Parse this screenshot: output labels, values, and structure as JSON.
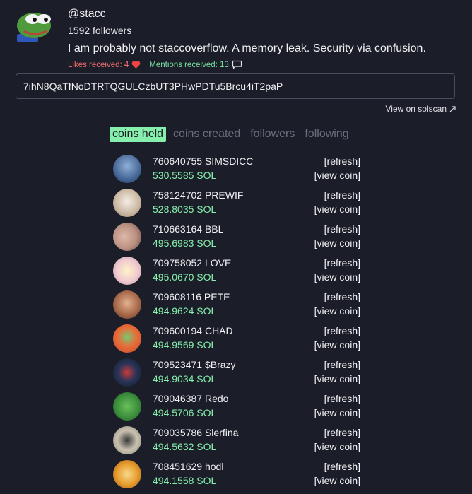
{
  "profile": {
    "username": "@stacc",
    "followers": "1592 followers",
    "bio": "I am probably not staccoverflow. A memory leak. Security via confusion.",
    "likes_label": "Likes received: 4",
    "mentions_label": "Mentions received: 13",
    "avatar_icon": "pepe-frog-avatar"
  },
  "address": {
    "value": "7ihN8QaTfNoDTRTQGULCzbUT3PHwPDTu5Brcu4iT2paP",
    "solscan_label": "View on solscan"
  },
  "tabs": [
    {
      "label": "coins held",
      "active": true
    },
    {
      "label": "coins created",
      "active": false
    },
    {
      "label": "followers",
      "active": false
    },
    {
      "label": "following",
      "active": false
    }
  ],
  "coins": [
    {
      "name": "760640755 SIMSDICC",
      "sol": "530.5585 SOL",
      "refresh": "[refresh]",
      "view": "[view coin]",
      "color": "#3a5a8a",
      "icon": "simsdicc-avatar"
    },
    {
      "name": "758124702 PREWIF",
      "sol": "528.8035 SOL",
      "refresh": "[refresh]",
      "view": "[view coin]",
      "color": "#c9b6a0",
      "icon": "prewif-avatar"
    },
    {
      "name": "710663164 BBL",
      "sol": "495.6983 SOL",
      "refresh": "[refresh]",
      "view": "[view coin]",
      "color": "#b88f80",
      "icon": "bbl-avatar"
    },
    {
      "name": "709758052 LOVE",
      "sol": "495.0670 SOL",
      "refresh": "[refresh]",
      "view": "[view coin]",
      "color": "#f0c9d0",
      "icon": "love-avatar"
    },
    {
      "name": "709608116 PETE",
      "sol": "494.9624 SOL",
      "refresh": "[refresh]",
      "view": "[view coin]",
      "color": "#a86a4a",
      "icon": "pete-avatar"
    },
    {
      "name": "709600194 CHAD",
      "sol": "494.9569 SOL",
      "refresh": "[refresh]",
      "view": "[view coin]",
      "color": "#e86d3a",
      "icon": "chad-avatar"
    },
    {
      "name": "709523471 $Brazy",
      "sol": "494.9034 SOL",
      "refresh": "[refresh]",
      "view": "[view coin]",
      "color": "#2a3558",
      "icon": "brazy-avatar"
    },
    {
      "name": "709046387 Redo",
      "sol": "494.5706 SOL",
      "refresh": "[refresh]",
      "view": "[view coin]",
      "color": "#3d8f3d",
      "icon": "redo-avatar"
    },
    {
      "name": "709035786 Slerfina",
      "sol": "494.5632 SOL",
      "refresh": "[refresh]",
      "view": "[view coin]",
      "color": "#c9c2b0",
      "icon": "slerfina-avatar"
    },
    {
      "name": "708451629 hodl",
      "sol": "494.1558 SOL",
      "refresh": "[refresh]",
      "view": "[view coin]",
      "color": "#e8a030",
      "icon": "hodl-avatar"
    }
  ]
}
